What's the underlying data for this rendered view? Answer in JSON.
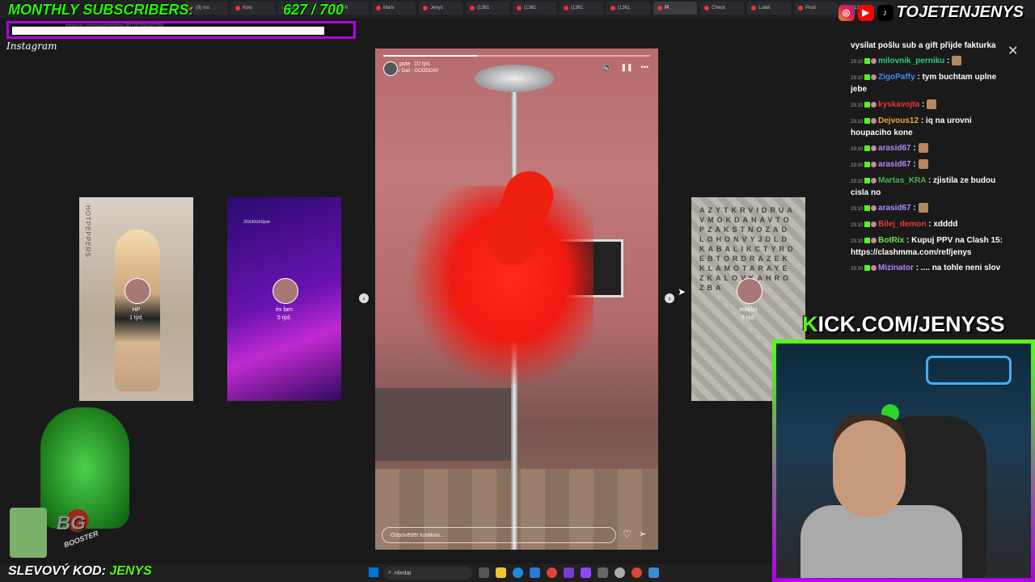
{
  "overlay": {
    "monthly_label": "MONTHLY SUBSCRIBERS:",
    "sub_count": "627 / 700",
    "social_handle": "TOJETENJENYS",
    "kick_label_k": "K",
    "kick_label_rest": "ICK.COM/JENYSS",
    "promo_label": "SLEVOVÝ KOD:",
    "promo_code": "JENYS",
    "booster_logo": "BG",
    "booster_text": "BOOSTER"
  },
  "browser": {
    "tabs": [
      {
        "label": "(9) Ins",
        "active": false
      },
      {
        "label": "Kolo",
        "active": false
      },
      {
        "label": "Kolo",
        "active": false
      },
      {
        "label": "Dash",
        "active": false
      },
      {
        "label": "Marv",
        "active": false
      },
      {
        "label": "Jenys",
        "active": false
      },
      {
        "label": "(1361",
        "active": false
      },
      {
        "label": "(1361",
        "active": false
      },
      {
        "label": "(1361",
        "active": false
      },
      {
        "label": "(1361",
        "active": false
      },
      {
        "label": "Pi",
        "active": true
      },
      {
        "label": "Check",
        "active": false
      },
      {
        "label": "Lulak",
        "active": false
      },
      {
        "label": "Prod",
        "active": false
      },
      {
        "label": "(1361",
        "active": false
      }
    ],
    "url": "instagram.com/stories/highlights/18071075581607196/"
  },
  "instagram": {
    "logo": "Instagram",
    "side_stories": [
      {
        "name": "HP",
        "age": "1 týd."
      },
      {
        "name": "ex fam",
        "age": "5 týd.",
        "watermark": "zlocktoxique"
      },
      {
        "name": "miláčci",
        "age": "5 týd.",
        "watermark": "AZYTKRVIDRUAVMOKDANAVTOPZAKSTNOZADLOHONVYJDLDKABALIKCTYRDEBTORDRAZEKKLAMOTARAYEZKALOVKAHROZBA"
      }
    ],
    "main_story": {
      "user": "pole",
      "time": "10 týd.",
      "music": "Dali · GOODDAY",
      "progress": 0.35,
      "reply_placeholder": "Odpovědět lusilikav..."
    },
    "close_icon": "✕",
    "prev_icon": "‹",
    "next_icon": "›"
  },
  "chat": {
    "top_text": "vysílat pošlu sub a gift přijde fakturka",
    "messages": [
      {
        "time": "23:10",
        "user": "milovnik_perniku",
        "color": "#2ecc71",
        "text": "",
        "emote": true
      },
      {
        "time": "23:10",
        "user": "ZigoPaffy",
        "color": "#3b8bff",
        "text": ": tym buchtam uplne jebe",
        "emote": false
      },
      {
        "time": "23:10",
        "user": "kyskavojta",
        "color": "#e53935",
        "text": "",
        "emote": true
      },
      {
        "time": "23:10",
        "user": "Dejvous12",
        "color": "#f4a340",
        "text": ": iq na urovni houpaciho kone",
        "emote": false
      },
      {
        "time": "23:10",
        "user": "arasid67",
        "color": "#b388ff",
        "text": "",
        "emote": true
      },
      {
        "time": "23:10",
        "user": "arasid67",
        "color": "#b388ff",
        "text": "",
        "emote": true
      },
      {
        "time": "23:10",
        "user": "Martas_KRA",
        "color": "#4caf50",
        "text": ": zjistila ze budou cisla no",
        "emote": false
      },
      {
        "time": "23:10",
        "user": "arasid67",
        "color": "#b388ff",
        "text": "",
        "emote": true
      },
      {
        "time": "23:10",
        "user": "Bilej_demon",
        "color": "#e53935",
        "text": ": xdddd",
        "emote": false
      },
      {
        "time": "23:10",
        "user": "BotRix",
        "color": "#7cdf59",
        "text": ": Kupuj PPV na Clash 15: https://clashmma.com/ref/jenys",
        "emote": false
      },
      {
        "time": "23:10",
        "user": "Mizinator",
        "color": "#b388ff",
        "text": ": .... na tohle neni slov",
        "emote": false
      }
    ]
  },
  "taskbar": {
    "search_label": "Hledat"
  },
  "colors": {
    "kick_green": "#53fc18",
    "accent_purple": "#b100e8"
  }
}
